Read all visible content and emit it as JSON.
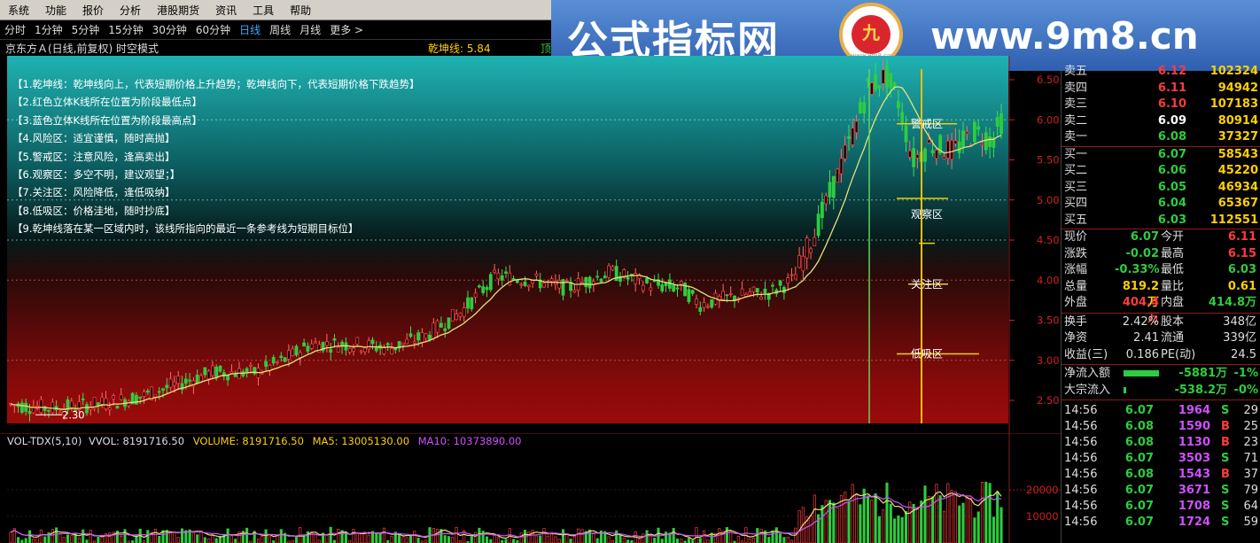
{
  "menu": [
    "系统",
    "功能",
    "报价",
    "分析",
    "港股期货",
    "资讯",
    "工具",
    "帮助"
  ],
  "periods": [
    "分时",
    "1分钟",
    "5分钟",
    "15分钟",
    "30分钟",
    "60分钟",
    "日线",
    "周线",
    "月线",
    "更多 >"
  ],
  "active_period": "日线",
  "chart_title": "京东方Ａ(日线,前复权) 时空模式",
  "indicator_label": "乾坤线: 5.84",
  "indicator_tail": "顶",
  "banner": {
    "site_cn": "公式指标网",
    "site_url": "www.9m8.cn",
    "logo_text": "九",
    "logo_small": "www.9m8.cn"
  },
  "notes": [
    "【1.乾坤线：乾坤线向上，代表短期价格上升趋势；乾坤线向下，代表短期价格下跌趋势】",
    "【2.红色立体K线所在位置为阶段最低点】",
    "【3.蓝色立体K线所在位置为阶段最高点】",
    "【4.风险区：适宜谨慎，随时高抛】",
    "【5.警戒区：注意风险，逢高卖出】",
    "【6.观察区：多空不明，建议观望；】",
    "【7.关注区：风险降低，逢低吸纳】",
    "【8.低吸区：价格洼地，随时抄底】",
    "【9.乾坤线落在某一区域内时，该线所指向的最近一条参考线为短期目标位】"
  ],
  "zones": [
    "警戒区",
    "观察区",
    "关注区",
    "低吸区"
  ],
  "price_axis": [
    "6.50",
    "6.00",
    "5.50",
    "5.00",
    "4.50",
    "4.00",
    "3.50",
    "3.00",
    "2.50"
  ],
  "low_label": "2.30",
  "vol_header": {
    "name": "VOL-TDX(5,10)",
    "vvol": "VVOL: 8191716.50",
    "volume": "VOLUME: 8191716.50",
    "ma5": "MA5: 13005130.00",
    "ma10": "MA10: 10373890.00"
  },
  "vol_axis": [
    "20000",
    "10000"
  ],
  "order_book": {
    "sell": [
      {
        "label": "卖五",
        "price": "6.12",
        "vol": "102324"
      },
      {
        "label": "卖四",
        "price": "6.11",
        "vol": "94942"
      },
      {
        "label": "卖三",
        "price": "6.10",
        "vol": "107183"
      },
      {
        "label": "卖二",
        "price": "6.09",
        "vol": "80914"
      },
      {
        "label": "卖一",
        "price": "6.08",
        "vol": "37327"
      }
    ],
    "buy": [
      {
        "label": "买一",
        "price": "6.07",
        "vol": "58543"
      },
      {
        "label": "买二",
        "price": "6.06",
        "vol": "45220"
      },
      {
        "label": "买三",
        "price": "6.05",
        "vol": "46934"
      },
      {
        "label": "买四",
        "price": "6.04",
        "vol": "65367"
      },
      {
        "label": "买五",
        "price": "6.03",
        "vol": "112551"
      }
    ]
  },
  "stats": [
    {
      "l1": "现价",
      "v1": "6.07",
      "c1": "#2ecc40",
      "l2": "今开",
      "v2": "6.11",
      "c2": "#ff3b3b"
    },
    {
      "l1": "涨跌",
      "v1": "-0.02",
      "c1": "#2ecc40",
      "l2": "最高",
      "v2": "6.15",
      "c2": "#ff3b3b"
    },
    {
      "l1": "涨幅",
      "v1": "-0.33%",
      "c1": "#2ecc40",
      "l2": "最低",
      "v2": "6.03",
      "c2": "#2ecc40"
    },
    {
      "l1": "总量",
      "v1": "819.2万",
      "c1": "#ffd000",
      "l2": "量比",
      "v2": "0.61",
      "c2": "#ffd000"
    },
    {
      "l1": "外盘",
      "v1": "404.4万",
      "c1": "#ff3b3b",
      "l2": "内盘",
      "v2": "414.8万",
      "c2": "#2ecc40"
    }
  ],
  "fund": [
    {
      "l1": "换手",
      "v1": "2.42%",
      "l2": "股本",
      "v2": "348亿"
    },
    {
      "l1": "净资",
      "v1": "2.41",
      "l2": "流通",
      "v2": "339亿"
    },
    {
      "l1": "收益(三)",
      "v1": "0.186",
      "l2": "PE(动)",
      "v2": "24.5"
    }
  ],
  "flows": [
    {
      "label": "净流入额",
      "value": "-5881万",
      "pct": "-1%"
    },
    {
      "label": "大宗流入",
      "value": "-538.2万",
      "pct": "-0%"
    }
  ],
  "ticks": [
    {
      "t": "14:56",
      "p": "6.07",
      "v": "1964",
      "bs": "S",
      "n": "29"
    },
    {
      "t": "14:56",
      "p": "6.08",
      "v": "1590",
      "bs": "B",
      "n": "25"
    },
    {
      "t": "14:56",
      "p": "6.08",
      "v": "1130",
      "bs": "B",
      "n": "23"
    },
    {
      "t": "14:56",
      "p": "6.07",
      "v": "3503",
      "bs": "S",
      "n": "71"
    },
    {
      "t": "14:56",
      "p": "6.08",
      "v": "1543",
      "bs": "B",
      "n": "37"
    },
    {
      "t": "14:56",
      "p": "6.07",
      "v": "3671",
      "bs": "S",
      "n": "79"
    },
    {
      "t": "14:56",
      "p": "6.07",
      "v": "1708",
      "bs": "S",
      "n": "64"
    },
    {
      "t": "14:56",
      "p": "6.07",
      "v": "1724",
      "bs": "S",
      "n": "59"
    }
  ],
  "colors": {
    "up": "#ff3b3b",
    "down": "#2ecc40",
    "ma": "#e8e07a",
    "axis": "#c22222",
    "accent": "#4aa3ff"
  }
}
